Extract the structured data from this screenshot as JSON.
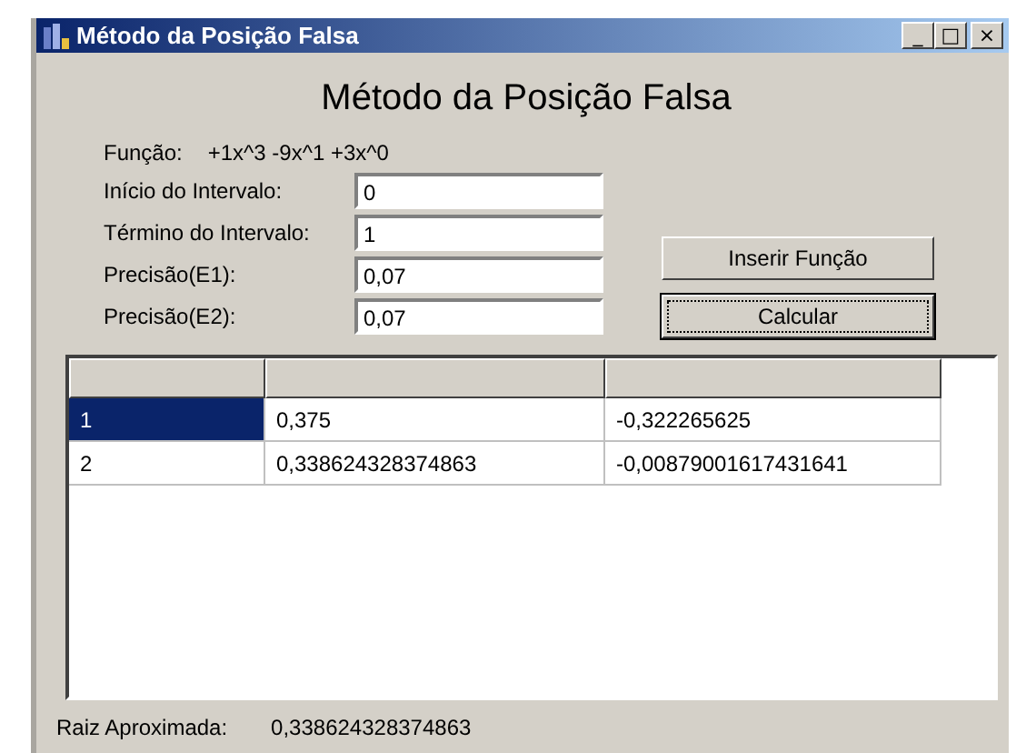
{
  "window": {
    "title": "Método da Posição Falsa",
    "controls": [
      "_",
      "□",
      "×"
    ]
  },
  "heading": "Método da Posição Falsa",
  "function": {
    "label": "Função:",
    "value": "+1x^3 -9x^1 +3x^0"
  },
  "fields": [
    {
      "label": "Início do Intervalo:",
      "value": "0"
    },
    {
      "label": "Término do Intervalo:",
      "value": "1"
    },
    {
      "label": "Precisão(E1):",
      "value": "0,07"
    },
    {
      "label": "Precisão(E2):",
      "value": "0,07"
    }
  ],
  "buttons": [
    {
      "label": "Inserir Função",
      "focused": false
    },
    {
      "label": "Calcular",
      "focused": true
    }
  ],
  "table": {
    "rows": [
      {
        "cells": [
          "1",
          "0,375",
          "-0,322265625"
        ],
        "selected": true
      },
      {
        "cells": [
          "2",
          "0,338624328374863",
          "-0,00879001617431641"
        ],
        "selected": false
      }
    ]
  },
  "result": {
    "label": "Raiz Aproximada:",
    "value": "0,338624328374863"
  }
}
